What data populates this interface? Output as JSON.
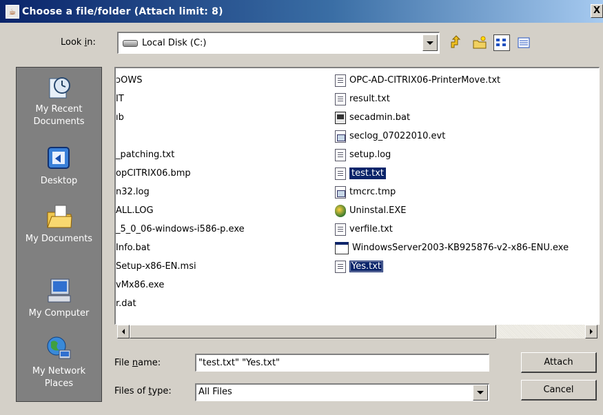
{
  "window": {
    "title": "Choose a file/folder  (Attach limit: 8)",
    "close": "X"
  },
  "lookin": {
    "label_pre": "Look ",
    "label_key": "i",
    "label_post": "n:",
    "value": "Local Disk (C:)"
  },
  "toolbar": {
    "up_icon": "up-folder-icon",
    "new_folder_icon": "new-folder-icon",
    "list_icon": "list-view-icon",
    "details_icon": "details-view-icon"
  },
  "places": [
    {
      "line1": "My Recent",
      "line2": "Documents",
      "icon": "recent-documents-icon"
    },
    {
      "line1": "Desktop",
      "line2": "",
      "icon": "desktop-icon"
    },
    {
      "line1": "My Documents",
      "line2": "",
      "icon": "my-documents-icon"
    },
    {
      "line1": "My Computer",
      "line2": "",
      "icon": "my-computer-icon"
    },
    {
      "line1": "My Network",
      "line2": "Places",
      "icon": "network-places-icon"
    }
  ],
  "files_col1": [
    "ᴐOWS",
    "IT",
    "ıb",
    "",
    "_patching.txt",
    "opCITRIX06.bmp",
    "n32.log",
    "ALL.LOG",
    "_5_0_06-windows-i586-p.exe",
    "Info.bat",
    "Setup-x86-EN.msi",
    "vMx86.exe",
    "r.dat"
  ],
  "files_col2": [
    {
      "name": "OPC-AD-CITRIX06-PrinterMove.txt",
      "type": "txt",
      "selected": false
    },
    {
      "name": "result.txt",
      "type": "txt",
      "selected": false
    },
    {
      "name": "secadmin.bat",
      "type": "bat",
      "selected": false
    },
    {
      "name": "seclog_07022010.evt",
      "type": "evt",
      "selected": false
    },
    {
      "name": "setup.log",
      "type": "txt",
      "selected": false
    },
    {
      "name": "test.txt",
      "type": "txt",
      "selected": true
    },
    {
      "name": "tmcrc.tmp",
      "type": "evt",
      "selected": false
    },
    {
      "name": "Uninstal.EXE",
      "type": "exe",
      "selected": false
    },
    {
      "name": "verfile.txt",
      "type": "txt",
      "selected": false
    },
    {
      "name": "WindowsServer2003-KB925876-v2-x86-ENU.exe",
      "type": "win",
      "selected": false
    },
    {
      "name": "Yes.txt",
      "type": "txt",
      "selected": true
    }
  ],
  "filename": {
    "label_pre": "File ",
    "label_key": "n",
    "label_post": "ame:",
    "value": "\"test.txt\" \"Yes.txt\""
  },
  "filetype": {
    "label_pre": "Files of ",
    "label_key": "t",
    "label_post": "ype:",
    "value": "All Files"
  },
  "buttons": {
    "attach": "Attach",
    "cancel": "Cancel"
  }
}
